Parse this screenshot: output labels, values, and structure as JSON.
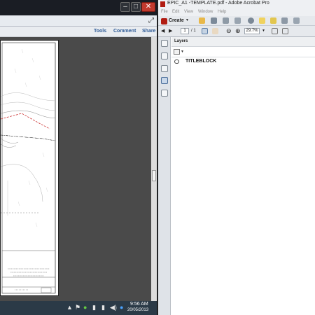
{
  "left_window": {
    "tabs": [
      "Tools",
      "Comment",
      "Share"
    ],
    "taskbar": {
      "time": "9:56 AM",
      "date": "20/05/2013"
    }
  },
  "acrobat": {
    "title": "EPIC_A1 -TEMPLATE.pdf - Adobe Acrobat Pro",
    "menu": [
      "File",
      "Edit",
      "View",
      "Window",
      "Help"
    ],
    "create_label": "Create",
    "page_current": "1",
    "page_total": "/ 1",
    "zoom": "29.7%",
    "panel_title": "Layers",
    "layers": [
      {
        "name": "TITLEBLOCK"
      }
    ]
  },
  "colors": {
    "acrobat_red": "#b11c12",
    "tab_blue": "#2d5a96",
    "taskbar": "#2b3a47"
  }
}
